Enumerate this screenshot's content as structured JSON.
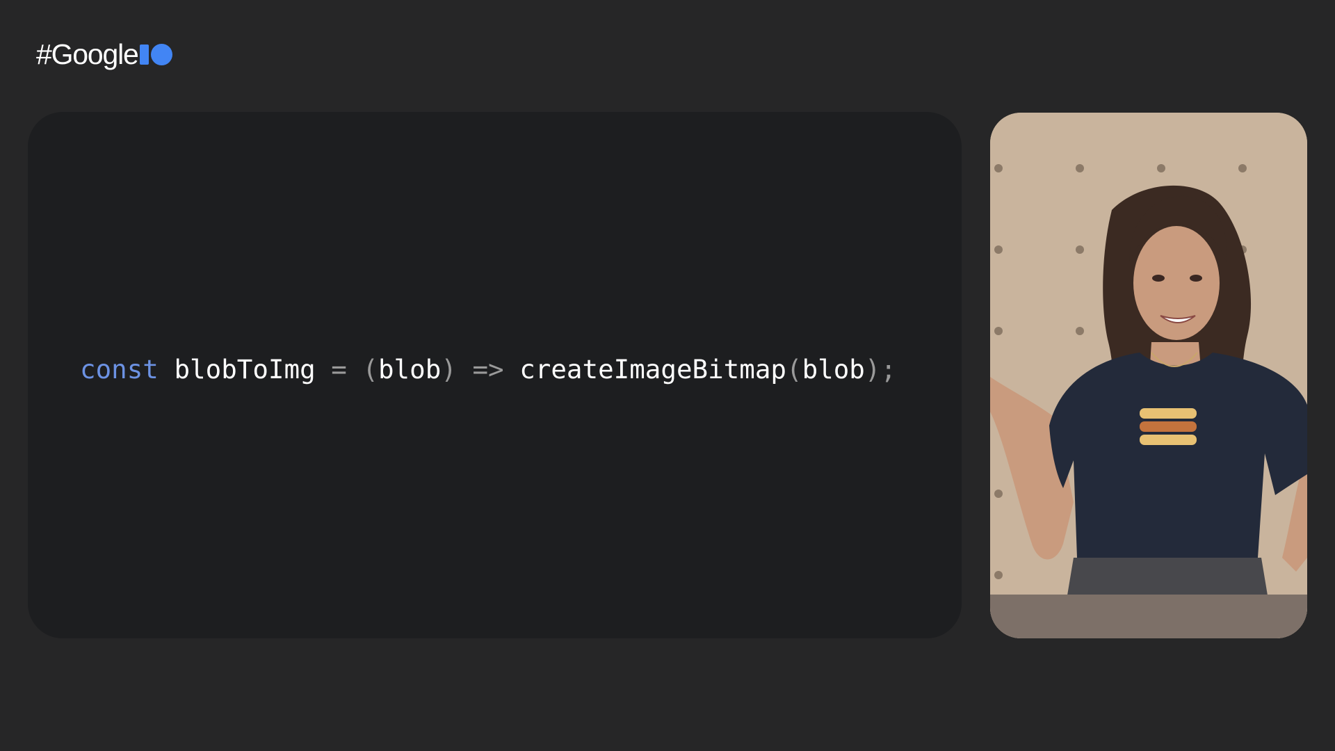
{
  "logo": {
    "text": "#Google",
    "i_color": "#4285f4",
    "o_color": "#4285f4"
  },
  "code": {
    "tokens": [
      {
        "text": "const",
        "role": "keyword",
        "color": "#6c92e3"
      },
      {
        "text": " ",
        "role": "space",
        "color": "#ffffff"
      },
      {
        "text": "blobToImg",
        "role": "identifier",
        "color": "#ffffff"
      },
      {
        "text": " ",
        "role": "space",
        "color": "#ffffff"
      },
      {
        "text": "=",
        "role": "operator",
        "color": "#9a9a9a"
      },
      {
        "text": " ",
        "role": "space",
        "color": "#ffffff"
      },
      {
        "text": "(",
        "role": "punctuation",
        "color": "#9a9a9a"
      },
      {
        "text": "blob",
        "role": "identifier",
        "color": "#ffffff"
      },
      {
        "text": ")",
        "role": "punctuation",
        "color": "#9a9a9a"
      },
      {
        "text": " ",
        "role": "space",
        "color": "#ffffff"
      },
      {
        "text": "=>",
        "role": "operator",
        "color": "#9a9a9a"
      },
      {
        "text": " ",
        "role": "space",
        "color": "#ffffff"
      },
      {
        "text": "createImageBitmap",
        "role": "identifier",
        "color": "#ffffff"
      },
      {
        "text": "(",
        "role": "punctuation",
        "color": "#9a9a9a"
      },
      {
        "text": "blob",
        "role": "identifier",
        "color": "#ffffff"
      },
      {
        "text": ")",
        "role": "punctuation",
        "color": "#9a9a9a"
      },
      {
        "text": ";",
        "role": "punctuation",
        "color": "#9a9a9a"
      }
    ]
  },
  "video": {
    "subject": "presenter-video",
    "colors": {
      "wall": "#c9b49d",
      "peg": "#8c7a68",
      "shirt": "#232a3a",
      "skin": "#c99b7e",
      "hair": "#3b2a22",
      "jeans": "#48484c",
      "table": "#7d7068"
    }
  }
}
